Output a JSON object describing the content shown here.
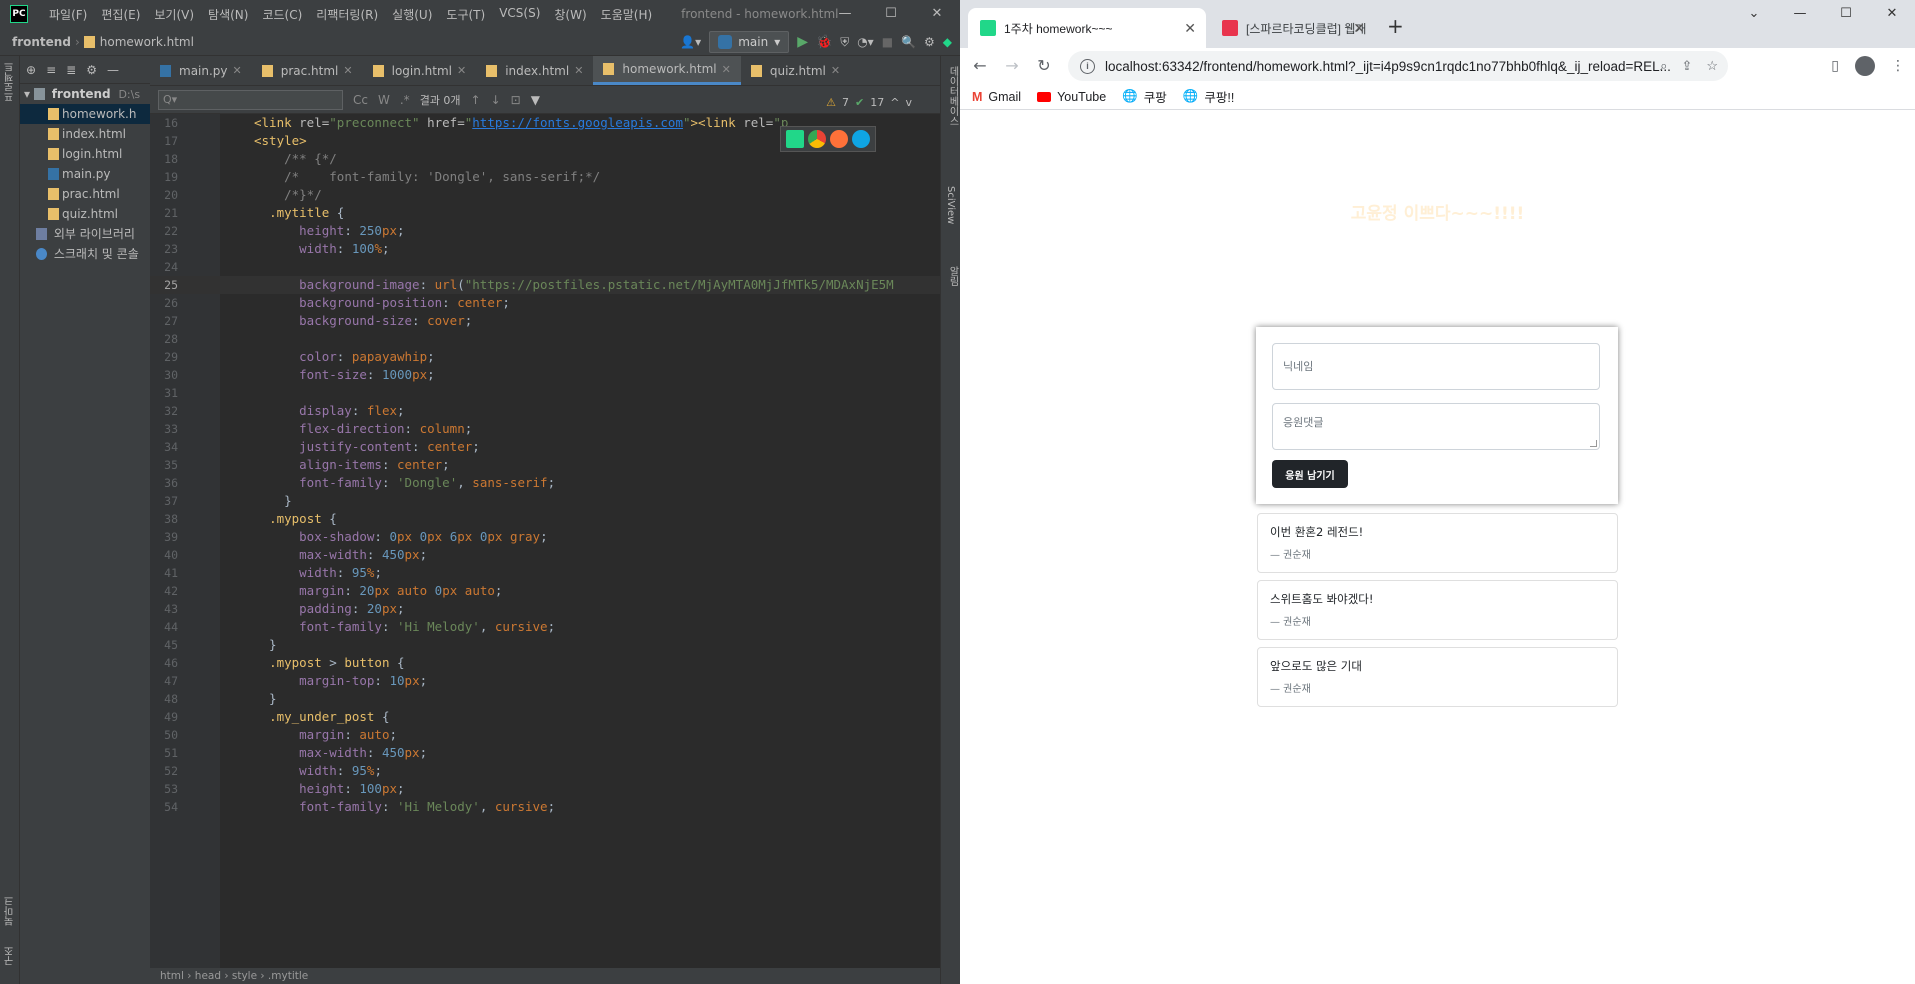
{
  "ide": {
    "menus": [
      "파일(F)",
      "편집(E)",
      "보기(V)",
      "탐색(N)",
      "코드(C)",
      "리팩터링(R)",
      "실행(U)",
      "도구(T)",
      "VCS(S)",
      "창(W)",
      "도움말(H)"
    ],
    "window_title": "frontend - homework.html",
    "project_name": "frontend",
    "current_file": "homework.html",
    "branch": "main",
    "project_path": "D:\\s",
    "tree": {
      "root": "frontend",
      "files": [
        "homework.h",
        "index.html",
        "login.html",
        "main.py",
        "prac.html",
        "quiz.html"
      ],
      "external": "외부 라이브러리",
      "scratch": "스크래치 및 콘솔"
    },
    "tabs": [
      "main.py",
      "prac.html",
      "login.html",
      "index.html",
      "homework.html",
      "quiz.html"
    ],
    "find": {
      "placeholder": "Q▾",
      "result": "결과 0개",
      "cc": "Cc",
      "w": "W",
      "regex": ".*"
    },
    "inspections": {
      "warnings": "7",
      "ok": "17"
    },
    "breadcrumb": "html › head › style › .mytitle",
    "left_strip": "프로젝트",
    "left_strip_bottom": "북마크",
    "left_strip_bottom2": "구조",
    "right_strip": [
      "데이터베이스",
      "SciView",
      "알림"
    ],
    "code_lines": [
      {
        "n": "16",
        "html": "<span class='c-tag'>&lt;link </span><span class='c-attr'>rel=</span><span class='c-str'>\"preconnect\"</span><span class='c-attr'> href=</span><span class='c-str'>\"<span class='c-lnk'>https://fonts.googleapis.com</span>\"</span><span class='c-tag'>&gt;&lt;link </span><span class='c-attr'>rel=</span><span class='c-str'>\"p</span>"
      },
      {
        "n": "17",
        "html": "<span class='c-tag'>&lt;style&gt;</span>"
      },
      {
        "n": "18",
        "html": "    <span class='c-com'>/** {*/</span>"
      },
      {
        "n": "19",
        "html": "    <span class='c-com'>/*    font-family: 'Dongle', sans-serif;*/</span>"
      },
      {
        "n": "20",
        "html": "    <span class='c-com'>/*}*/</span>"
      },
      {
        "n": "21",
        "html": "  <span class='c-sel'>.mytitle</span> {"
      },
      {
        "n": "22",
        "html": "      <span class='c-prop'>height</span>: <span class='c-num'>250</span><span class='c-kw'>px</span>;"
      },
      {
        "n": "23",
        "html": "      <span class='c-prop'>width</span>: <span class='c-num'>100</span><span class='c-kw'>%</span>;"
      },
      {
        "n": "24",
        "html": ""
      },
      {
        "n": "25",
        "html": "      <span class='c-prop'>background-image</span>: <span class='c-kw'>url</span>(<span class='c-str'>\"https://postfiles.pstatic.net/MjAyMTA0MjJfMTk5/MDAxNjE5M</span>"
      },
      {
        "n": "26",
        "html": "      <span class='c-prop'>background-position</span>: <span class='c-kw'>center</span>;"
      },
      {
        "n": "27",
        "html": "      <span class='c-prop'>background-size</span>: <span class='c-kw'>cover</span>;"
      },
      {
        "n": "28",
        "html": ""
      },
      {
        "n": "29",
        "html": "      <span class='c-prop'>color</span>: <span class='c-kw'>papayawhip</span>;"
      },
      {
        "n": "30",
        "html": "      <span class='c-prop'>font-size</span>: <span class='c-num'>1000</span><span class='c-kw'>px</span>;"
      },
      {
        "n": "31",
        "html": ""
      },
      {
        "n": "32",
        "html": "      <span class='c-prop'>display</span>: <span class='c-kw'>flex</span>;"
      },
      {
        "n": "33",
        "html": "      <span class='c-prop'>flex-direction</span>: <span class='c-kw'>column</span>;"
      },
      {
        "n": "34",
        "html": "      <span class='c-prop'>justify-content</span>: <span class='c-kw'>center</span>;"
      },
      {
        "n": "35",
        "html": "      <span class='c-prop'>align-items</span>: <span class='c-kw'>center</span>;"
      },
      {
        "n": "36",
        "html": "      <span class='c-prop'>font-family</span>: <span class='c-str'>'Dongle'</span>, <span class='c-kw'>sans-serif</span>;"
      },
      {
        "n": "37",
        "html": "    }"
      },
      {
        "n": "38",
        "html": "  <span class='c-sel'>.mypost</span> {"
      },
      {
        "n": "39",
        "html": "      <span class='c-prop'>box-shadow</span>: <span class='c-num'>0</span><span class='c-kw'>px</span> <span class='c-num'>0</span><span class='c-kw'>px</span> <span class='c-num'>6</span><span class='c-kw'>px</span> <span class='c-num'>0</span><span class='c-kw'>px</span> <span class='c-kw'>gray</span>;"
      },
      {
        "n": "40",
        "html": "      <span class='c-prop'>max-width</span>: <span class='c-num'>450</span><span class='c-kw'>px</span>;"
      },
      {
        "n": "41",
        "html": "      <span class='c-prop'>width</span>: <span class='c-num'>95</span><span class='c-kw'>%</span>;"
      },
      {
        "n": "42",
        "html": "      <span class='c-prop'>margin</span>: <span class='c-num'>20</span><span class='c-kw'>px</span> <span class='c-kw'>auto</span> <span class='c-num'>0</span><span class='c-kw'>px</span> <span class='c-kw'>auto</span>;"
      },
      {
        "n": "43",
        "html": "      <span class='c-prop'>padding</span>: <span class='c-num'>20</span><span class='c-kw'>px</span>;"
      },
      {
        "n": "44",
        "html": "      <span class='c-prop'>font-family</span>: <span class='c-str'>'Hi Melody'</span>, <span class='c-kw'>cursive</span>;"
      },
      {
        "n": "45",
        "html": "  }"
      },
      {
        "n": "46",
        "html": "  <span class='c-sel'>.mypost</span> &gt; <span class='c-sel'>button</span> {"
      },
      {
        "n": "47",
        "html": "      <span class='c-prop'>margin-top</span>: <span class='c-num'>10</span><span class='c-kw'>px</span>;"
      },
      {
        "n": "48",
        "html": "  }"
      },
      {
        "n": "49",
        "html": "  <span class='c-sel'>.my_under_post</span> {"
      },
      {
        "n": "50",
        "html": "      <span class='c-prop'>margin</span>: <span class='c-kw'>auto</span>;"
      },
      {
        "n": "51",
        "html": "      <span class='c-prop'>max-width</span>: <span class='c-num'>450</span><span class='c-kw'>px</span>;"
      },
      {
        "n": "52",
        "html": "      <span class='c-prop'>width</span>: <span class='c-num'>95</span><span class='c-kw'>%</span>;"
      },
      {
        "n": "53",
        "html": "      <span class='c-prop'>height</span>: <span class='c-num'>100</span><span class='c-kw'>px</span>;"
      },
      {
        "n": "54",
        "html": "      <span class='c-prop'>font-family</span>: <span class='c-str'>'Hi Melody'</span>, <span class='c-kw'>cursive</span>;"
      }
    ]
  },
  "browser": {
    "tabs": [
      {
        "title": "1주차 homework~~~"
      },
      {
        "title": "[스파르타코딩클럽] 웹개발 종합"
      }
    ],
    "url": "localhost:63342/frontend/homework.html?_ijt=i4p9s9cn1rqdc1no77bhb0fhlq&_ij_reload=REL...",
    "bookmarks": [
      "Gmail",
      "YouTube",
      "쿠팡",
      "쿠팡!!"
    ],
    "page": {
      "title": "고윤정 이쁘다~~~!!!!",
      "nickname_placeholder": "닉네임",
      "comment_placeholder": "응원댓글",
      "submit_label": "응원 남기기",
      "posts": [
        {
          "message": "이번 환혼2 레전드!",
          "author": "— 권순재"
        },
        {
          "message": "스위트홈도 봐야겠다!",
          "author": "— 권순재"
        },
        {
          "message": "앞으로도 많은 기대",
          "author": "— 권순재"
        }
      ]
    }
  },
  "colors": {
    "title_color": "#ffefd5",
    "accent": "#4a88c7"
  }
}
